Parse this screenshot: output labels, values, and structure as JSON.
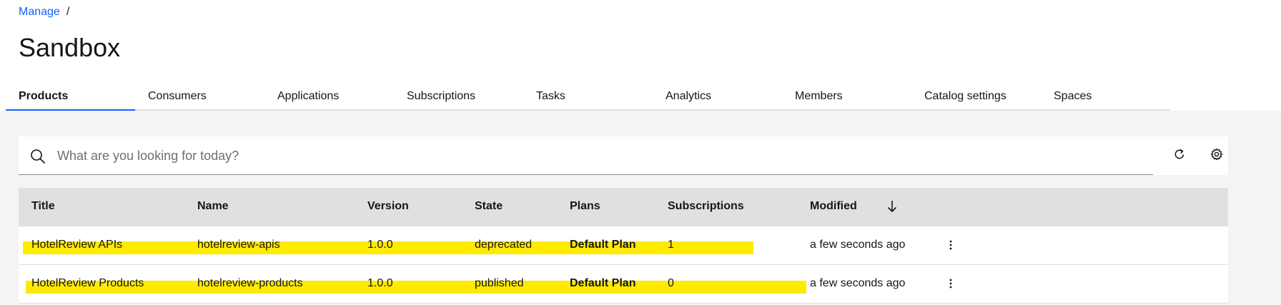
{
  "breadcrumb": {
    "link": "Manage",
    "separator": "/"
  },
  "page": {
    "title": "Sandbox"
  },
  "tabs": [
    {
      "label": "Products",
      "active": true
    },
    {
      "label": "Consumers"
    },
    {
      "label": "Applications"
    },
    {
      "label": "Subscriptions"
    },
    {
      "label": "Tasks"
    },
    {
      "label": "Analytics"
    },
    {
      "label": "Members"
    },
    {
      "label": "Catalog settings"
    },
    {
      "label": "Spaces"
    }
  ],
  "search": {
    "placeholder": "What are you looking for today?",
    "value": ""
  },
  "toolbar": {
    "refresh_icon": "refresh-icon",
    "settings_icon": "gear-icon"
  },
  "table": {
    "columns": [
      "Title",
      "Name",
      "Version",
      "State",
      "Plans",
      "Subscriptions",
      "Modified"
    ],
    "sort_icon": "arrow-down-icon",
    "rows": [
      {
        "title": "HotelReview APIs",
        "name": "hotelreview-apis",
        "version": "1.0.0",
        "state": "deprecated",
        "plans": "Default Plan",
        "subscriptions": "1",
        "modified": "a few seconds ago"
      },
      {
        "title": "HotelReview Products",
        "name": "hotelreview-products",
        "version": "1.0.0",
        "state": "published",
        "plans": "Default Plan",
        "subscriptions": "0",
        "modified": "a few seconds ago"
      }
    ]
  },
  "colors": {
    "accent": "#0f62fe",
    "highlight": "#ffea00",
    "header_bg": "#e0e0e0",
    "content_bg": "#f4f4f4"
  }
}
